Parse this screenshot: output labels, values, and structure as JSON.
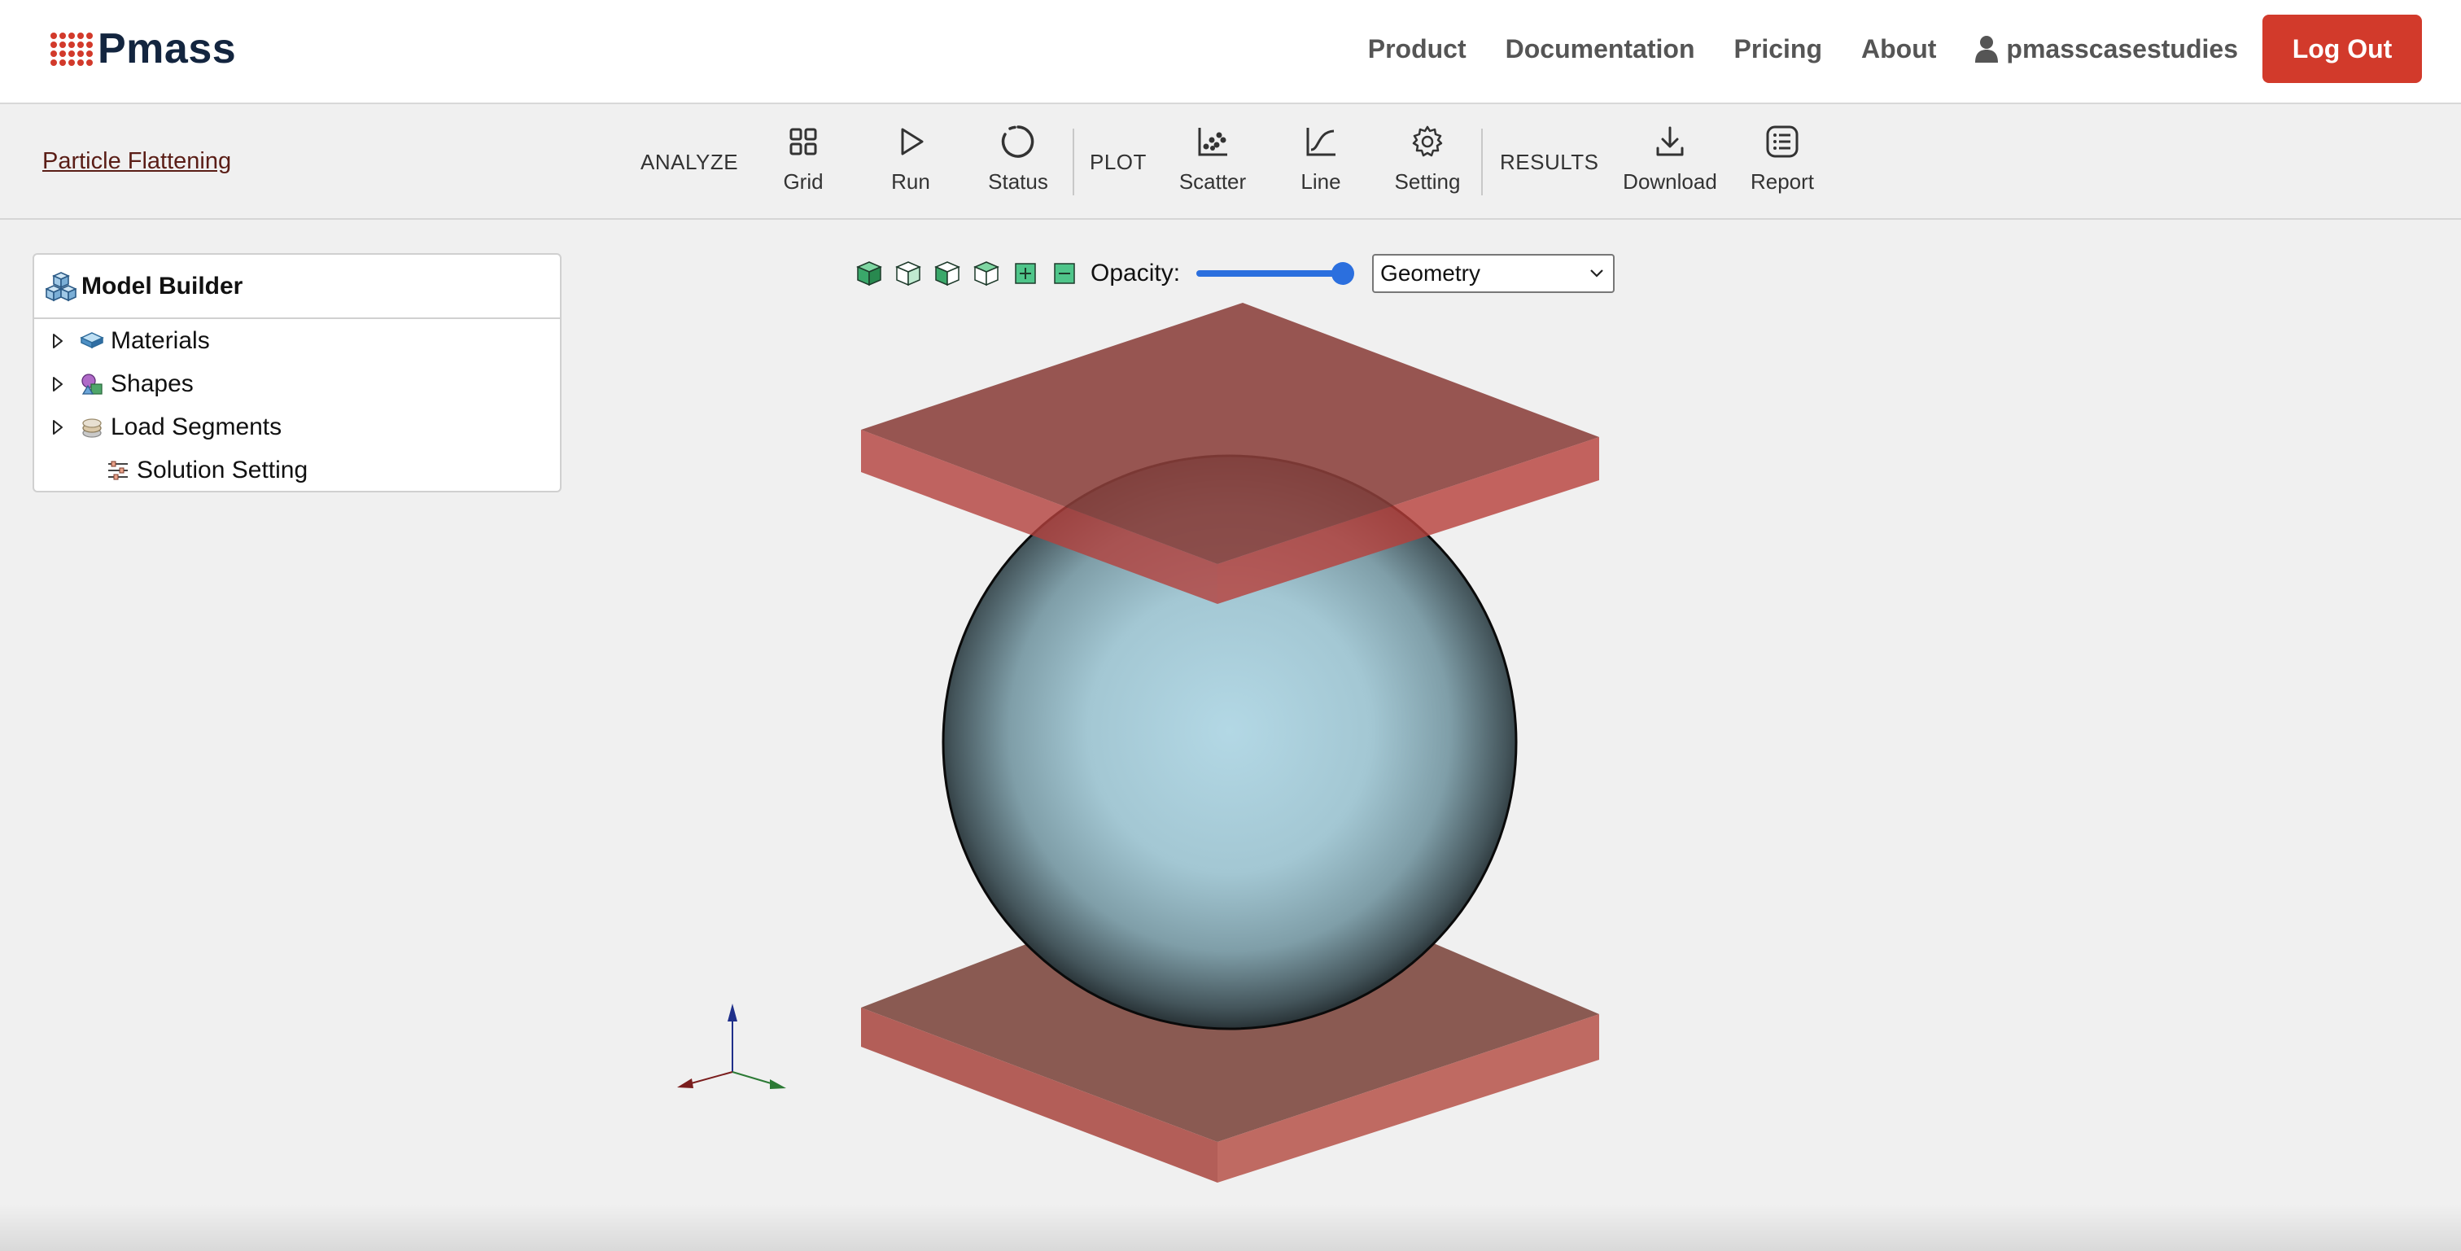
{
  "app": {
    "logo_text": "Pmass",
    "brand_color": "#d23a2b"
  },
  "nav": {
    "links": [
      "Product",
      "Documentation",
      "Pricing",
      "About"
    ],
    "username": "pmasscasestudies",
    "logout_label": "Log Out"
  },
  "toolbar": {
    "project_link": "Particle Flattening",
    "groups": {
      "analyze": "ANALYZE",
      "plot": "PLOT",
      "results": "RESULTS"
    },
    "buttons": {
      "grid": "Grid",
      "run": "Run",
      "status": "Status",
      "scatter": "Scatter",
      "line": "Line",
      "setting": "Setting",
      "download": "Download",
      "report": "Report"
    }
  },
  "model_builder": {
    "title": "Model Builder",
    "items": [
      {
        "label": "Materials",
        "expandable": true,
        "icon": "materials-icon"
      },
      {
        "label": "Shapes",
        "expandable": true,
        "icon": "shapes-icon"
      },
      {
        "label": "Load Segments",
        "expandable": true,
        "icon": "load-segments-icon"
      },
      {
        "label": "Solution Setting",
        "expandable": false,
        "icon": "solution-setting-icon"
      }
    ]
  },
  "viewer": {
    "opacity_label": "Opacity:",
    "opacity_value": 1.0,
    "display_mode": "Geometry",
    "plate_color": "#b3585a",
    "sphere_color": "#b2d6e2"
  }
}
